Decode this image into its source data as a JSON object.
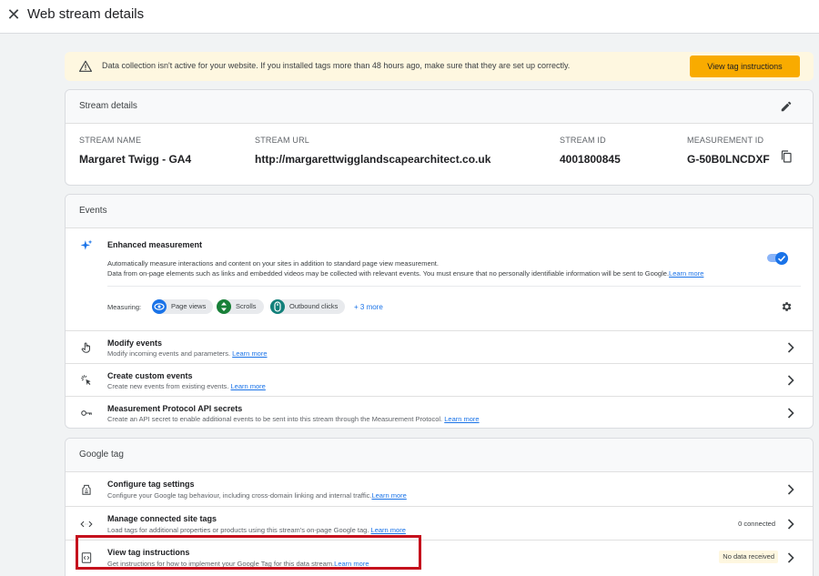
{
  "header": {
    "title": "Web stream details"
  },
  "banner": {
    "text": "Data collection isn't active for your website. If you installed tags more than 48 hours ago, make sure that they are set up correctly.",
    "button_label": "View tag instructions"
  },
  "stream_details": {
    "title": "Stream details",
    "fields": [
      {
        "label": "STREAM NAME",
        "value": "Margaret Twigg - GA4"
      },
      {
        "label": "STREAM URL",
        "value": "http://margarettwigglandscapearchitect.co.uk"
      },
      {
        "label": "STREAM ID",
        "value": "4001800845"
      },
      {
        "label": "MEASUREMENT ID",
        "value": "G-50B0LNCDXF"
      }
    ]
  },
  "events": {
    "title": "Events",
    "enhanced": {
      "title": "Enhanced measurement",
      "desc1": "Automatically measure interactions and content on your sites in addition to standard page view measurement.",
      "desc2": "Data from on-page elements such as links and embedded videos may be collected with relevant events. You must ensure that no personally identifiable information will be sent to Google.",
      "learn_more": "Learn more",
      "measuring_label": "Measuring:",
      "chips": [
        "Page views",
        "Scrolls",
        "Outbound clicks"
      ],
      "more": "+ 3 more",
      "enabled": true
    },
    "rows": [
      {
        "title": "Modify events",
        "desc": "Modify incoming events and parameters.",
        "link": "Learn more"
      },
      {
        "title": "Create custom events",
        "desc": "Create new events from existing events.",
        "link": "Learn more"
      },
      {
        "title": "Measurement Protocol API secrets",
        "desc": "Create an API secret to enable additional events to be sent into this stream through the Measurement Protocol.",
        "link": "Learn more"
      }
    ]
  },
  "google_tag": {
    "title": "Google tag",
    "rows": [
      {
        "title": "Configure tag settings",
        "desc": "Configure your Google tag behaviour, including cross-domain linking and internal traffic.",
        "link": "Learn more",
        "status": ""
      },
      {
        "title": "Manage connected site tags",
        "desc": "Load tags for additional properties or products using this stream's on-page Google tag.",
        "link": "Learn more",
        "status": "0 connected"
      },
      {
        "title": "View tag instructions",
        "desc": "Get instructions for how to implement your Google Tag for this data stream.",
        "link": "Learn more",
        "status": "No data received"
      }
    ]
  },
  "colors": {
    "accent": "#1a73e8",
    "warning": "#f9ab00",
    "highlight": "#c5111d"
  }
}
